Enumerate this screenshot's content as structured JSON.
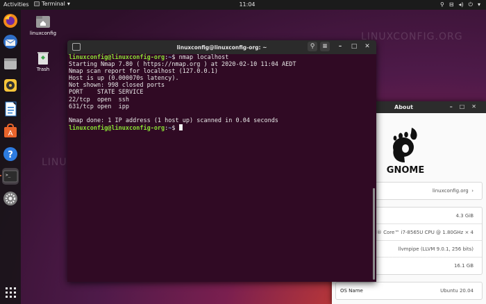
{
  "topbar": {
    "activities": "Activities",
    "app_name": "Terminal",
    "clock": "11:04"
  },
  "desktop": {
    "home_label": "linuxconfig",
    "trash_label": "Trash",
    "watermark": "LINUXCONFIG.ORG"
  },
  "dock": {
    "items": [
      "firefox-icon",
      "thunderbird-icon",
      "files-icon",
      "rhythmbox-icon",
      "libreoffice-writer-icon",
      "software-icon",
      "help-icon",
      "terminal-icon",
      "settings-icon",
      "show-applications-icon"
    ]
  },
  "terminal": {
    "title": "linuxconfig@linuxconfig-org: ~",
    "lines": [
      {
        "prompt": "linuxconfig@linuxconfig-org",
        "cwd": "~",
        "cmd": "nmap localhost"
      },
      {
        "text": "Starting Nmap 7.80 ( https://nmap.org ) at 2020-02-10 11:04 AEDT"
      },
      {
        "text": "Nmap scan report for localhost (127.0.0.1)"
      },
      {
        "text": "Host is up (0.000070s latency)."
      },
      {
        "text": "Not shown: 998 closed ports"
      },
      {
        "text": "PORT    STATE SERVICE"
      },
      {
        "text": "22/tcp  open  ssh"
      },
      {
        "text": "631/tcp open  ipp"
      },
      {
        "text": ""
      },
      {
        "text": "Nmap done: 1 IP address (1 host up) scanned in 0.04 seconds"
      }
    ],
    "final_prompt": {
      "prompt": "linuxconfig@linuxconfig-org",
      "cwd": "~"
    }
  },
  "about": {
    "title": "About",
    "logo_text": "GNOME",
    "device_name": "linuxconfig.org",
    "memory": "4.3 GiB",
    "processor": "el® Core™ i7-8565U CPU @ 1.80GHz × 4",
    "graphics": "llvmpipe (LLVM 9.0.1, 256 bits)",
    "disk": "16.1 GB",
    "os_name_label": "OS Name",
    "os_name": "Ubuntu 20.04"
  }
}
